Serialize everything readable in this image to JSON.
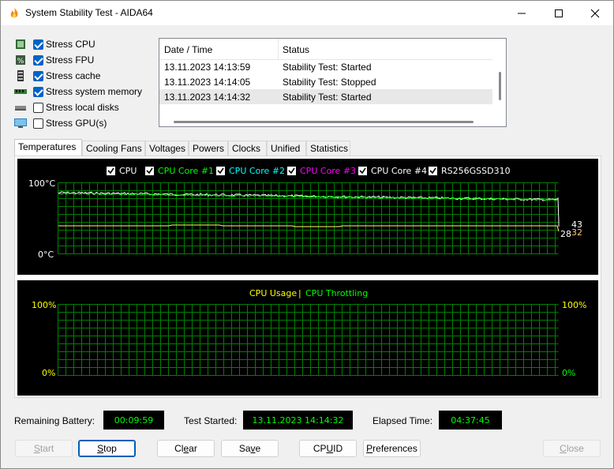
{
  "window": {
    "title": "System Stability Test - AIDA64"
  },
  "stress": [
    {
      "label": "Stress CPU",
      "checked": true,
      "icon": "cpu-icon"
    },
    {
      "label": "Stress FPU",
      "checked": true,
      "icon": "fpu-icon"
    },
    {
      "label": "Stress cache",
      "checked": true,
      "icon": "cache-icon"
    },
    {
      "label": "Stress system memory",
      "checked": true,
      "icon": "memory-icon"
    },
    {
      "label": "Stress local disks",
      "checked": false,
      "icon": "disk-icon"
    },
    {
      "label": "Stress GPU(s)",
      "checked": false,
      "icon": "gpu-icon"
    }
  ],
  "log": {
    "columns": [
      "Date / Time",
      "Status"
    ],
    "rows": [
      [
        "13.11.2023 14:13:59",
        "Stability Test: Started"
      ],
      [
        "13.11.2023 14:14:05",
        "Stability Test: Stopped"
      ],
      [
        "13.11.2023 14:14:32",
        "Stability Test: Started"
      ]
    ]
  },
  "tabs": [
    "Temperatures",
    "Cooling Fans",
    "Voltages",
    "Powers",
    "Clocks",
    "Unified",
    "Statistics"
  ],
  "temp_graph": {
    "legend": [
      {
        "label": "CPU",
        "color": "#ffffff"
      },
      {
        "label": "CPU Core #1",
        "color": "#00ff00"
      },
      {
        "label": "CPU Core #2",
        "color": "#00ffff"
      },
      {
        "label": "CPU Core #3",
        "color": "#ff00ff"
      },
      {
        "label": "CPU Core #4",
        "color": "#ffffff"
      },
      {
        "label": "RS256GSSD310",
        "color": "#ffffff"
      }
    ],
    "y_top": "100°C",
    "y_bottom": "0°C",
    "readouts": [
      "43",
      "28",
      "32"
    ]
  },
  "usage_graph": {
    "title_left": "CPU Usage",
    "title_sep": "|",
    "title_right": "CPU Throttling",
    "left_top": "100%",
    "left_bottom": "0%",
    "right_top": "100%",
    "right_bottom": "0%"
  },
  "status": {
    "battery_label": "Remaining Battery:",
    "battery_value": "00:09:59",
    "started_label": "Test Started:",
    "started_value": "13.11.2023 14:14:32",
    "elapsed_label": "Elapsed Time:",
    "elapsed_value": "04:37:45"
  },
  "buttons": {
    "start_acc": "S",
    "start_rest": "tart",
    "stop_acc": "S",
    "stop_rest": "top",
    "clear_pre": "Cl",
    "clear_acc": "e",
    "clear_rest": "ar",
    "save_pre": "Sa",
    "save_acc": "v",
    "save_rest": "e",
    "cpuid_pre": "CP",
    "cpuid_acc": "U",
    "cpuid_rest": "ID",
    "pref_acc": "P",
    "pref_rest": "references",
    "close_acc": "C",
    "close_rest": "lose"
  },
  "colors": {
    "graph_bg": "#000000",
    "grid": "#008000",
    "accent": "#0063c5",
    "usage_title": "#ffff00",
    "throttle_title": "#00ff00"
  }
}
